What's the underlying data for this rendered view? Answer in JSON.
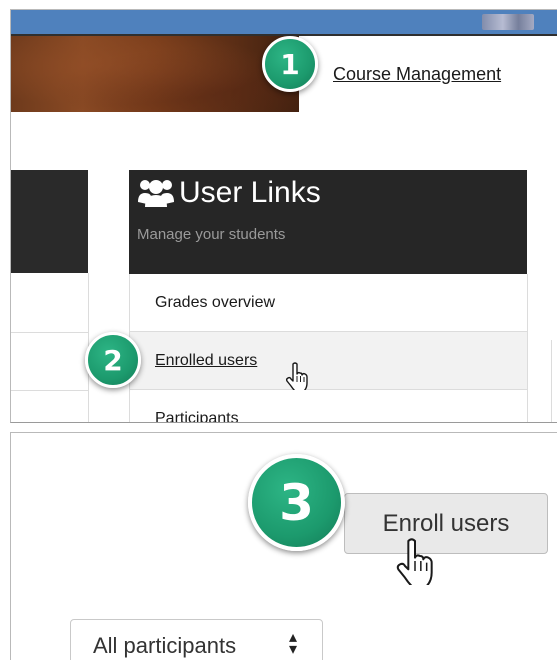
{
  "top_panel": {
    "course_management_link": "Course Management",
    "user_links_block": {
      "title": "User Links",
      "subtitle": "Manage your students",
      "items": [
        {
          "label": "Grades overview"
        },
        {
          "label": "Enrolled users"
        },
        {
          "label": "Participants"
        }
      ]
    }
  },
  "bottom_panel": {
    "enroll_button": "Enroll users",
    "participants_filter": {
      "selected": "All participants"
    }
  },
  "badges": {
    "step1": "1",
    "step2": "2",
    "step3": "3"
  },
  "colors": {
    "top_bar": "#4f81bd",
    "block_header": "#262626",
    "badge": "#1c9a6d",
    "button_bg": "#e9e9e9"
  },
  "icons": {
    "block_icon": "users-icon",
    "cursor": "hand-pointer-icon",
    "select_caret": "sort-caret-icon"
  }
}
